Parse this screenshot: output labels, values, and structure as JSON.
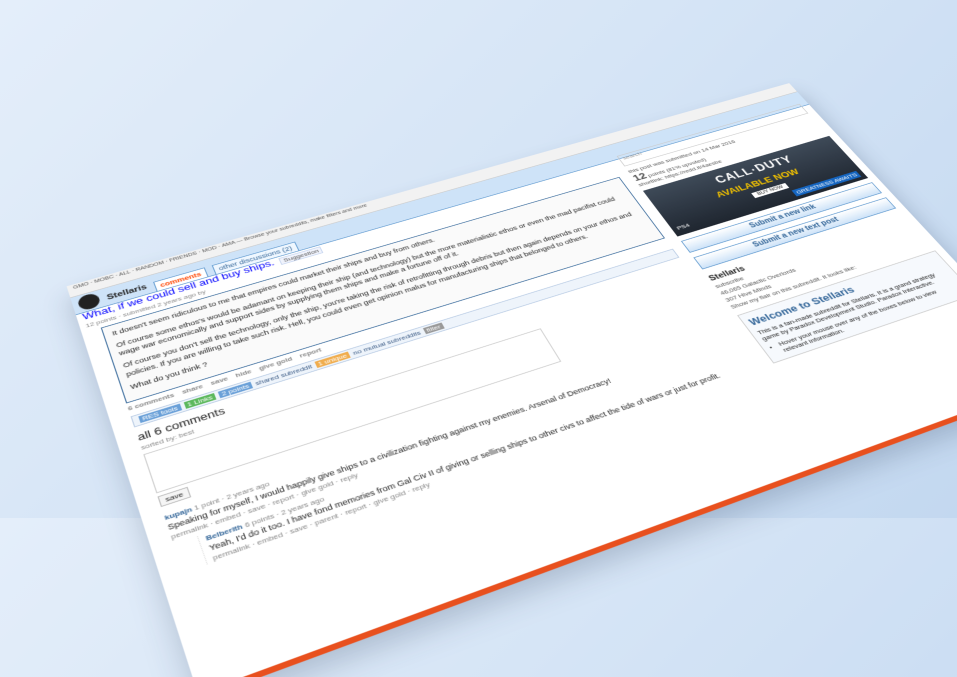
{
  "colors": {
    "accent": "#ff4500",
    "header": "#cee3f8",
    "link": "#0000ff",
    "edge": "#e8501e"
  },
  "topbar": {
    "text": "GMO · MOBC · ALL · RANDOM · FRIENDS · MOD · AMA — Browse your subreddits, make filters and more"
  },
  "header": {
    "subreddit": "Stellaris",
    "tabs": [
      "comments",
      "other discussions (2)"
    ]
  },
  "post": {
    "title": "What, if we could sell and buy ships.",
    "flair": "Suggestion",
    "meta": "12 points · submitted 2 years ago by",
    "selftext": [
      "It doesn't seem ridiculous to me that empires could market their ships and buy from others.",
      "Of course some ethos's would be adamant on keeping their ship (and technology) but the more materialistic ethos or even the mad pacifist could wage war economically and support sides by supplying them ships and make a fortune off of it.",
      "Of course you don't sell the technology, only the ship, you're taking the risk of retrofitting through debris but then again depends on your ethos and policies. If you are willing to take such risk. Hell, you could even get opinion malus for manufacturing ships that belonged to others.",
      "What do you think ?"
    ],
    "buttons": [
      "6 comments",
      "share",
      "save",
      "hide",
      "give gold",
      "report"
    ]
  },
  "res_bar": {
    "label": "RES tools",
    "items": [
      "1 Links",
      "2 points",
      "shared subreddit",
      "1 unique",
      "no mutual subreddits",
      "filter"
    ]
  },
  "comments": {
    "count_label": "all 6 comments",
    "sorted_label": "sorted by: best",
    "save_label": "save",
    "items": [
      {
        "author": "kupajn",
        "meta": "1 point · 2 years ago",
        "text": "Speaking for myself, I would happily give ships to a civilization fighting against my enemies. Arsenal of Democracy!",
        "actions": "permalink · embed · save · report · give gold · reply"
      },
      {
        "author": "Belberith",
        "meta": "6 points · 2 years ago",
        "text": "Yeah, I'd do it too. I have fond memories from Gal Civ II of giving or selling ships to other civs to affect the tide of wars or just for profit.",
        "actions": "permalink · embed · save · parent · report · give gold · reply"
      }
    ]
  },
  "sidebar": {
    "search_placeholder": "search",
    "post_score_line": "this post was submitted on 14 Mar 2016",
    "points_value": "12",
    "points_label": "points",
    "upvoted": "(81% upvoted)",
    "shortlink": "shortlink: https://redd.it/4aesbe",
    "ad": {
      "title": "CALL·DUTY",
      "subtitle": "AVAILABLE NOW",
      "buy": "BUY NOW",
      "platform": "PS4",
      "tag": "GREATNESS AWAITS"
    },
    "submit_link": "Submit a new link",
    "submit_text": "Submit a new text post",
    "subreddit_name": "Stellaris",
    "subscribe": "subscribe",
    "readers": "46,065 Galactic Overlords",
    "online": "307 Hive Minds",
    "mods_line": "Show my flair on this subreddit. It looks like:",
    "welcome_title": "Welcome to Stellaris",
    "welcome_text": "This is a fan-made subreddit for Stellaris. It is a grand strategy game by Paradox Development Studio. Paradox Interactive.",
    "welcome_items": [
      "Hover your mouse over any of the boxes below to view relevant information."
    ]
  }
}
